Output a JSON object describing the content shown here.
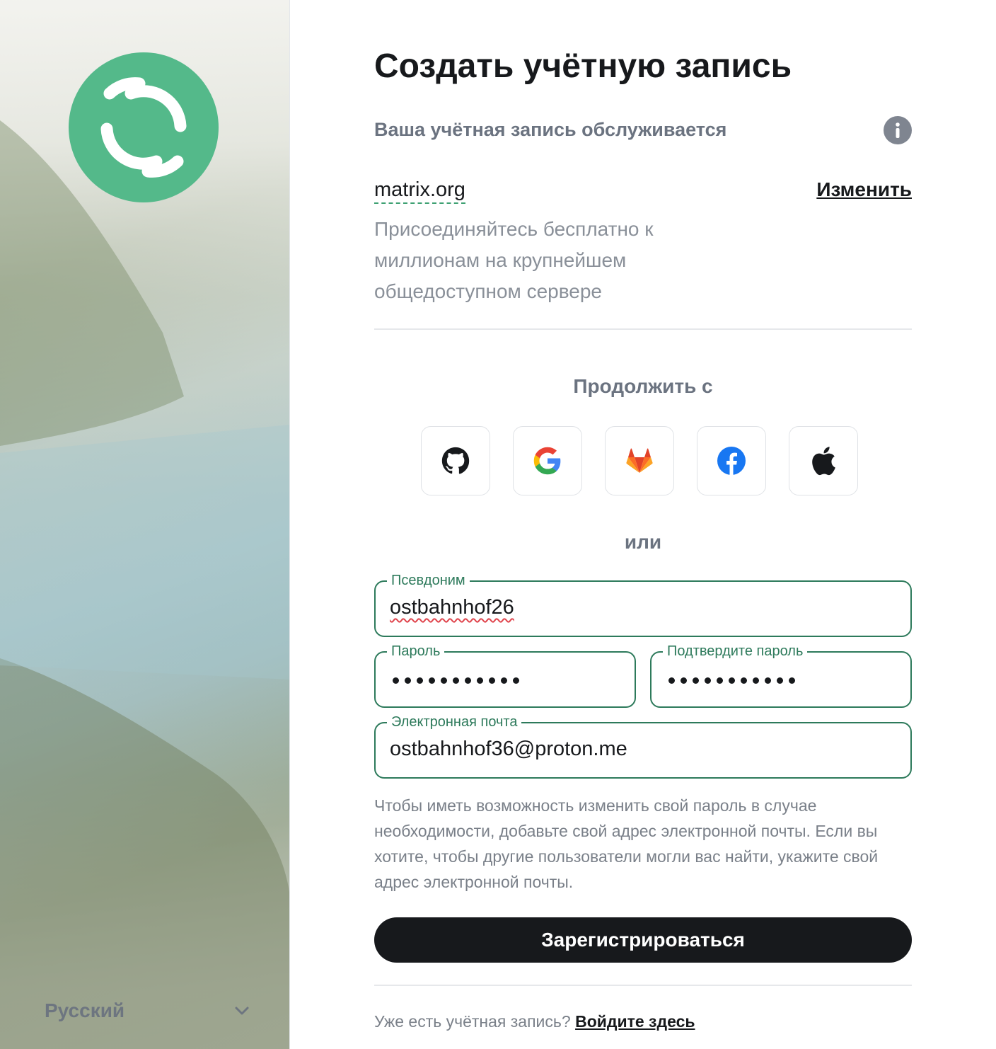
{
  "brand": {
    "accent": "#54b98a",
    "field_border": "#2d7a5b",
    "button_bg": "#17191c"
  },
  "sidebar": {
    "language": "Русский"
  },
  "title": "Создать учётную запись",
  "server": {
    "served_label": "Ваша учётная запись обслуживается",
    "name": "matrix.org",
    "change_label": "Изменить",
    "description": "Присоединяйтесь бесплатно к миллионам на крупнейшем общедоступном сервере"
  },
  "sso": {
    "heading": "Продолжить с",
    "providers": [
      "github-icon",
      "google-icon",
      "gitlab-icon",
      "facebook-icon",
      "apple-icon"
    ]
  },
  "or_label": "или",
  "form": {
    "username": {
      "label": "Псевдоним",
      "value": "ostbahnhof26"
    },
    "password": {
      "label": "Пароль",
      "masked_length": 11
    },
    "confirm_password": {
      "label": "Подтвердите пароль",
      "masked_length": 11
    },
    "email": {
      "label": "Электронная почта",
      "value": "ostbahnhof36@proton.me"
    },
    "help": "Чтобы иметь возможность изменить свой пароль в случае необходимости, добавьте свой адрес электронной почты. Если вы хотите, чтобы другие пользователи могли вас найти, укажите свой адрес электронной почты.",
    "submit_label": "Зарегистрироваться"
  },
  "footer": {
    "have_account": "Уже есть учётная запись?",
    "login_link": "Войдите здесь"
  }
}
